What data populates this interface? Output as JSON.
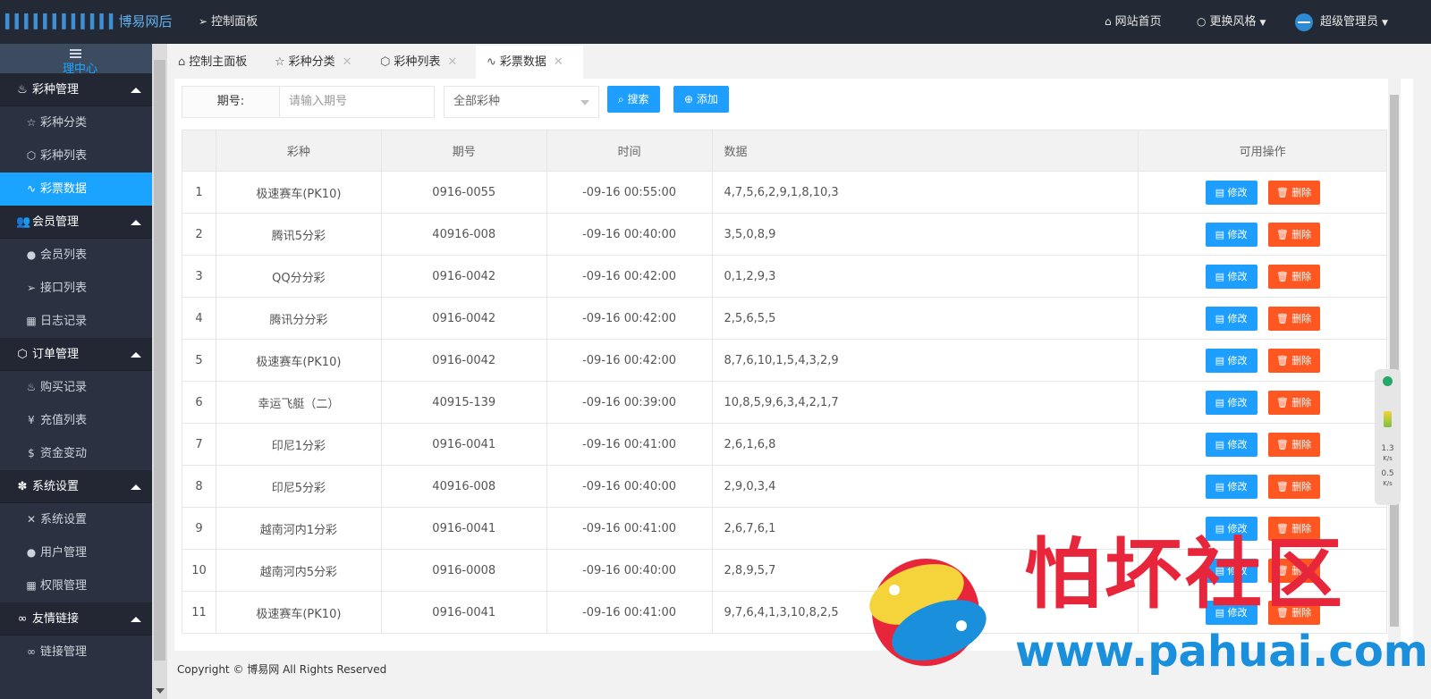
{
  "header": {
    "brand": "博易网后台管",
    "dashboard": "控制面板",
    "site_home": "网站首页",
    "change_style": "更换风格",
    "admin": "超级管理员"
  },
  "sidebar": {
    "toggle_text": "理中心",
    "groups": [
      {
        "label": "彩种管理",
        "items": [
          "彩种分类",
          "彩种列表",
          "彩票数据"
        ]
      },
      {
        "label": "会员管理",
        "items": [
          "会员列表",
          "接口列表",
          "日志记录"
        ]
      },
      {
        "label": "订单管理",
        "items": [
          "购买记录",
          "充值列表",
          "资金变动"
        ]
      },
      {
        "label": "系统设置",
        "items": [
          "系统设置",
          "用户管理",
          "权限管理"
        ]
      },
      {
        "label": "友情链接",
        "items": [
          "链接管理"
        ]
      }
    ]
  },
  "tabs": [
    {
      "label": "控制主面板"
    },
    {
      "label": "彩种分类"
    },
    {
      "label": "彩种列表"
    },
    {
      "label": "彩票数据"
    }
  ],
  "search": {
    "label": "期号:",
    "placeholder": "请输入期号",
    "select_value": "全部彩种",
    "search_btn": "搜索",
    "add_btn": "添加"
  },
  "table": {
    "headers": [
      "",
      "彩种",
      "期号",
      "时间",
      "数据",
      "可用操作"
    ],
    "edit_label": "修改",
    "delete_label": "删除",
    "rows": [
      {
        "no": "1",
        "type": "极速赛车(PK10)",
        "issue": "0916-0055",
        "time": "-09-16 00:55:00",
        "data": "4,7,5,6,2,9,1,8,10,3"
      },
      {
        "no": "2",
        "type": "腾讯5分彩",
        "issue": "40916-008",
        "time": "-09-16 00:40:00",
        "data": "3,5,0,8,9"
      },
      {
        "no": "3",
        "type": "QQ分分彩",
        "issue": "0916-0042",
        "time": "-09-16 00:42:00",
        "data": "0,1,2,9,3"
      },
      {
        "no": "4",
        "type": "腾讯分分彩",
        "issue": "0916-0042",
        "time": "-09-16 00:42:00",
        "data": "2,5,6,5,5"
      },
      {
        "no": "5",
        "type": "极速赛车(PK10)",
        "issue": "0916-0042",
        "time": "-09-16 00:42:00",
        "data": "8,7,6,10,1,5,4,3,2,9"
      },
      {
        "no": "6",
        "type": "幸运飞艇（二）",
        "issue": "40915-139",
        "time": "-09-16 00:39:00",
        "data": "10,8,5,9,6,3,4,2,1,7"
      },
      {
        "no": "7",
        "type": "印尼1分彩",
        "issue": "0916-0041",
        "time": "-09-16 00:41:00",
        "data": "2,6,1,6,8"
      },
      {
        "no": "8",
        "type": "印尼5分彩",
        "issue": "40916-008",
        "time": "-09-16 00:40:00",
        "data": "2,9,0,3,4"
      },
      {
        "no": "9",
        "type": "越南河内1分彩",
        "issue": "0916-0041",
        "time": "-09-16 00:41:00",
        "data": "2,6,7,6,1"
      },
      {
        "no": "10",
        "type": "越南河内5分彩",
        "issue": "0916-0008",
        "time": "-09-16 00:40:00",
        "data": "2,8,9,5,7"
      },
      {
        "no": "11",
        "type": "极速赛车(PK10)",
        "issue": "0916-0041",
        "time": "-09-16 00:41:00",
        "data": "9,7,6,4,1,3,10,8,2,5"
      }
    ]
  },
  "footer": {
    "copyright": "Copyright © 博易网 All Rights Reserved"
  },
  "widget": {
    "up": "1.3",
    "down": "0.5",
    "unit": "K/s"
  },
  "watermark": {
    "text": "怕坏社区",
    "url": "www.pahuai.com"
  },
  "colors": {
    "primary": "#1e9fff",
    "danger": "#ff5722",
    "sidebar": "#2b3141",
    "topbar": "#242a35"
  }
}
